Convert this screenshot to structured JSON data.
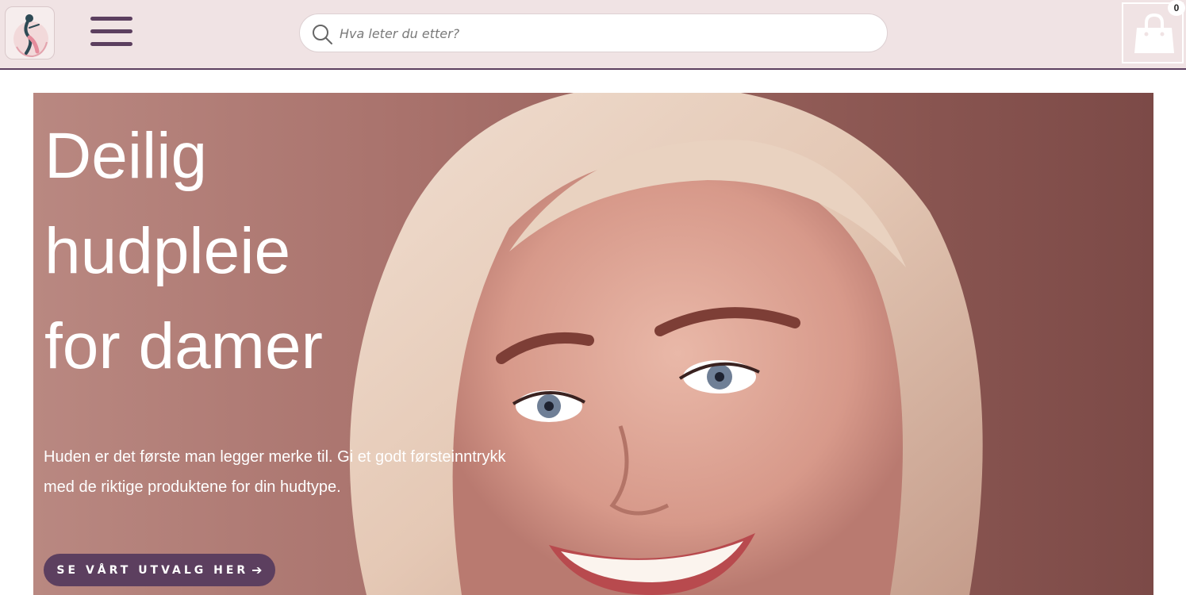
{
  "header": {
    "logo_icon": "woman-silhouette-logo",
    "menu_icon": "hamburger-menu-icon",
    "search": {
      "placeholder": "Hva leter du etter?",
      "value": "",
      "icon": "search-icon"
    },
    "cart": {
      "icon": "shopping-bag-icon",
      "count": "0"
    }
  },
  "hero": {
    "title_lines": [
      "Deilig",
      "hudpleie",
      "for damer"
    ],
    "text_lines": [
      "Huden er det første man legger merke til. Gi et godt førsteinntrykk",
      "med de riktige produktene for din hudtype."
    ],
    "cta_label": "SE VÅRT UTVALG HER",
    "cta_icon": "arrow-right-icon"
  },
  "colors": {
    "brand": "#5c3f5f",
    "header_bg": "#f0e3e4",
    "hero_bg": "#a8716b"
  }
}
